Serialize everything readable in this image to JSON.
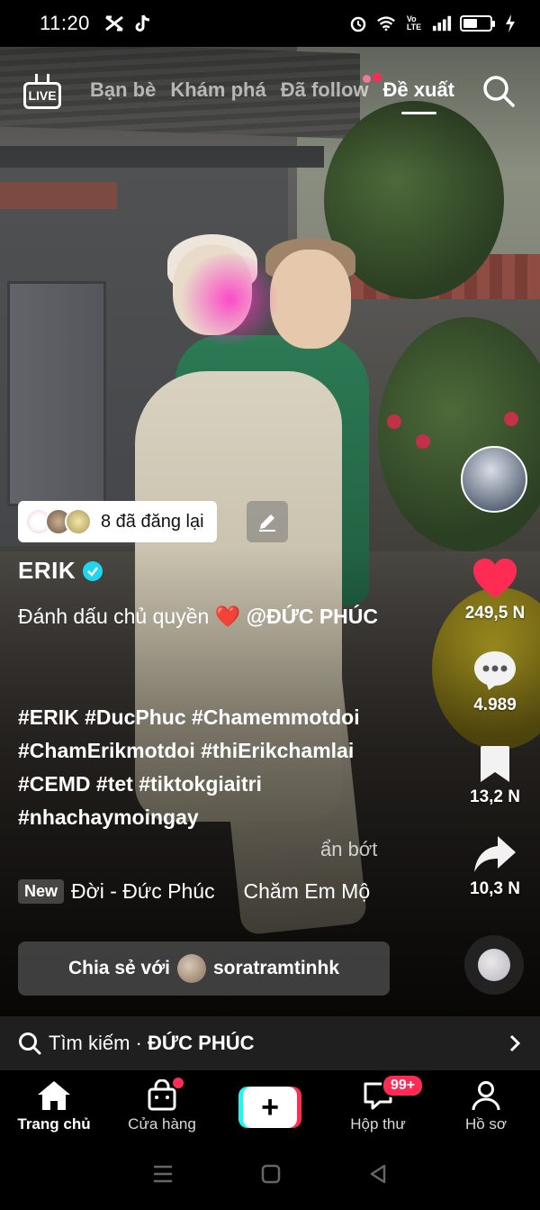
{
  "status_bar": {
    "time": "11:20",
    "battery_level": 0.55
  },
  "top_nav": {
    "live_label": "LIVE",
    "tabs": [
      {
        "label": "Bạn bè",
        "active": false
      },
      {
        "label": "Khám phá",
        "active": false
      },
      {
        "label": "Đã follow",
        "active": false
      },
      {
        "label": "Đề xuất",
        "active": true
      }
    ]
  },
  "repost": {
    "text": "8 đã đăng lại"
  },
  "post": {
    "author": "ERIK",
    "caption_text": "Đánh dấu chủ quyền ❤️",
    "caption_mention": "@ĐỨC PHÚC",
    "hashtags": "#ERIK #DucPhuc #Chamemmotdoi #ChamErikmotdoi #thiErikchamlai #CEMD #tet #tiktokgiaitri #nhachaymoingay",
    "less_label": "ẩn bớt",
    "music_badge": "New",
    "music_text": "Đời - Đức Phúc     Chăm Em Mộ"
  },
  "share": {
    "prefix": "Chia sẻ với",
    "username": "soratramtinhk"
  },
  "rail": {
    "likes": "249,5 N",
    "comments": "4.989",
    "saves": "13,2 N",
    "shares": "10,3 N"
  },
  "search_strip": {
    "prefix": "Tìm kiếm ·",
    "query": "ĐỨC PHÚC"
  },
  "bottom_nav": {
    "home": "Trang chủ",
    "shop": "Cửa hàng",
    "inbox": "Hộp thư",
    "inbox_badge": "99+",
    "profile": "Hồ sơ"
  },
  "colors": {
    "accent": "#fe2c55",
    "cyan": "#25f4ee",
    "verified": "#20d5ec"
  }
}
